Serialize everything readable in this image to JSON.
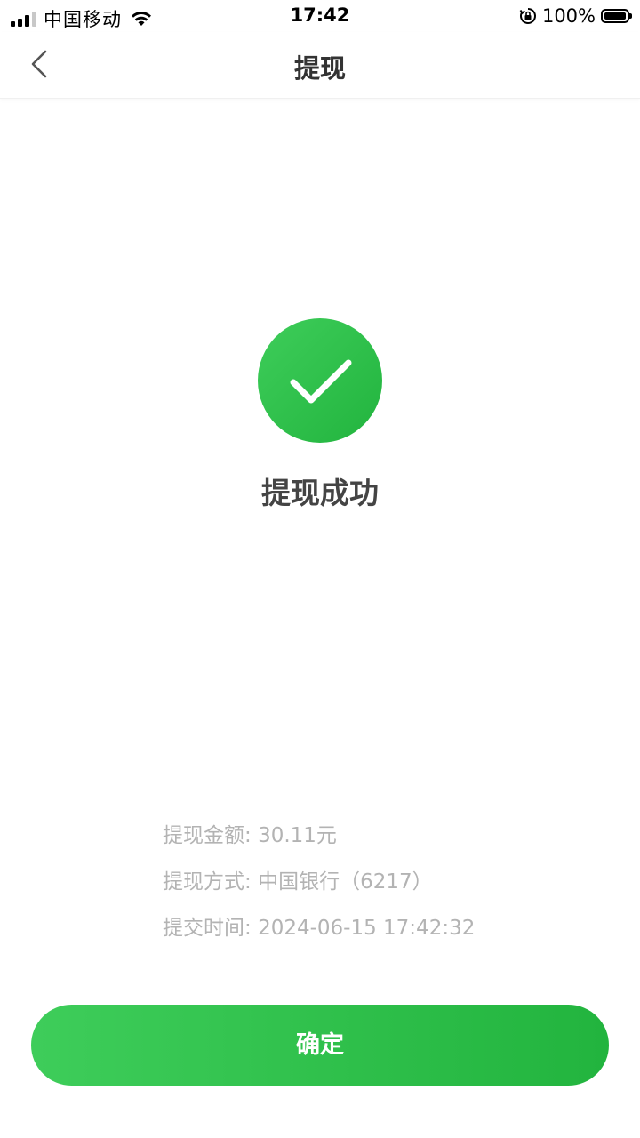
{
  "status_bar": {
    "carrier": "中国移动",
    "time": "17:42",
    "battery": "100%",
    "signal_icon": "signal-bars-icon",
    "wifi_icon": "wifi-icon",
    "lock_icon": "orientation-lock-icon",
    "battery_icon": "battery-icon"
  },
  "nav": {
    "back_icon": "chevron-left-icon",
    "title": "提现"
  },
  "result": {
    "icon": "check-circle-icon",
    "title": "提现成功",
    "accent_color": "#2BC046"
  },
  "details": [
    {
      "label": "提现金额:",
      "value": "30.11元"
    },
    {
      "label": "提现方式:",
      "value": "中国银行（6217）"
    },
    {
      "label": "提交时间:",
      "value": "2024-06-15 17:42:32"
    }
  ],
  "confirm_button": {
    "label": "确定"
  }
}
